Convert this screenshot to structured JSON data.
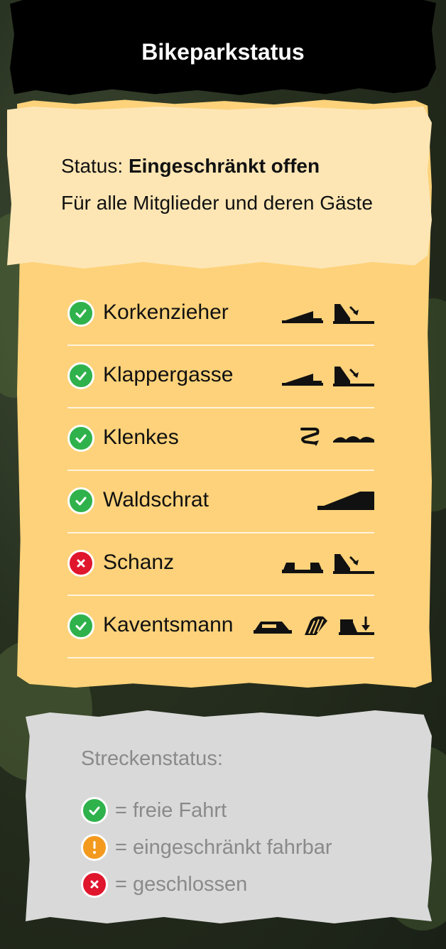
{
  "header": {
    "title": "Bikeparkstatus"
  },
  "status": {
    "label": "Status:",
    "value": "Eingeschränkt offen",
    "note": "Für alle Mitglieder und deren Gäste"
  },
  "tracks": [
    {
      "name": "Korkenzieher",
      "status": "open",
      "icons": [
        "ramp-icon",
        "drop-icon"
      ]
    },
    {
      "name": "Klappergasse",
      "status": "open",
      "icons": [
        "ramp-icon",
        "drop-icon"
      ]
    },
    {
      "name": "Klenkes",
      "status": "open",
      "icons": [
        "switchback-icon",
        "rollers-icon"
      ]
    },
    {
      "name": "Waldschrat",
      "status": "open",
      "icons": [
        "ramp-icon"
      ]
    },
    {
      "name": "Schanz",
      "status": "closed",
      "icons": [
        "tabletop-icon",
        "drop-icon"
      ]
    },
    {
      "name": "Kaventsmann",
      "status": "open",
      "icons": [
        "step-jump-icon",
        "wallride-icon",
        "step-down-icon"
      ]
    }
  ],
  "legend": {
    "title": "Streckenstatus:",
    "items": [
      {
        "label": "= freie Fahrt",
        "status": "open"
      },
      {
        "label": "= eingeschränkt fahrbar",
        "status": "limited"
      },
      {
        "label": "= geschlossen",
        "status": "closed"
      }
    ]
  },
  "colors": {
    "open": "#2fb24c",
    "limited": "#f39a1e",
    "closed": "#e0162d",
    "panel": "#fdd27a",
    "status_box": "#fde6b4",
    "legend_bg": "#d9d9d9"
  }
}
